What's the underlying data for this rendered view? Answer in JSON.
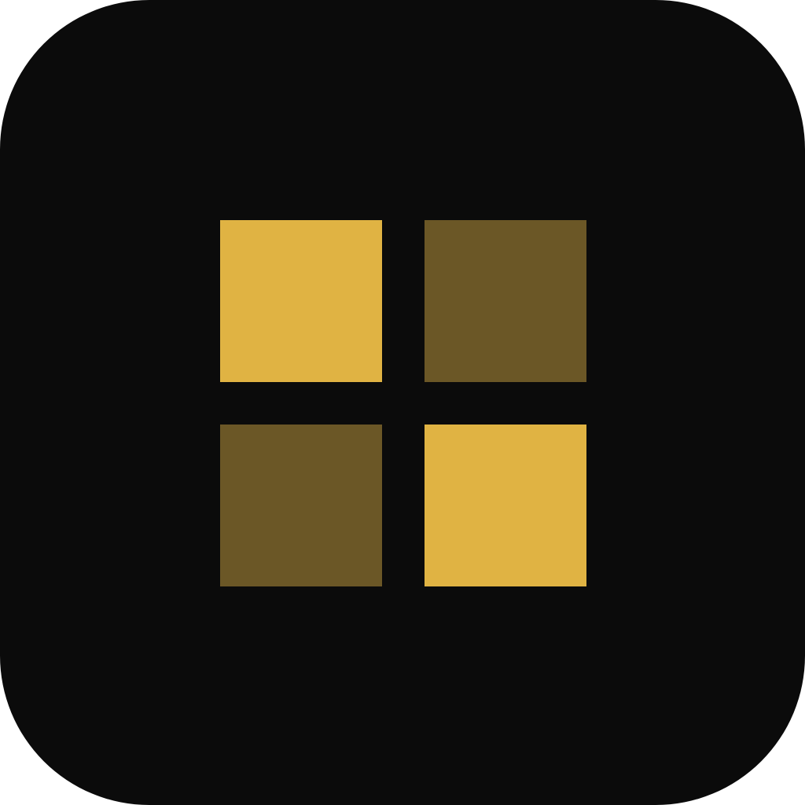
{
  "icon": {
    "name": "grid-app-icon",
    "background_color": "#0b0b0b",
    "colors": {
      "bright": "#e0b343",
      "dim": "#6b5726"
    },
    "tiles": [
      {
        "id": "top-left",
        "shade": "bright"
      },
      {
        "id": "top-right",
        "shade": "dim"
      },
      {
        "id": "bottom-left",
        "shade": "dim"
      },
      {
        "id": "bottom-right",
        "shade": "bright"
      }
    ]
  }
}
